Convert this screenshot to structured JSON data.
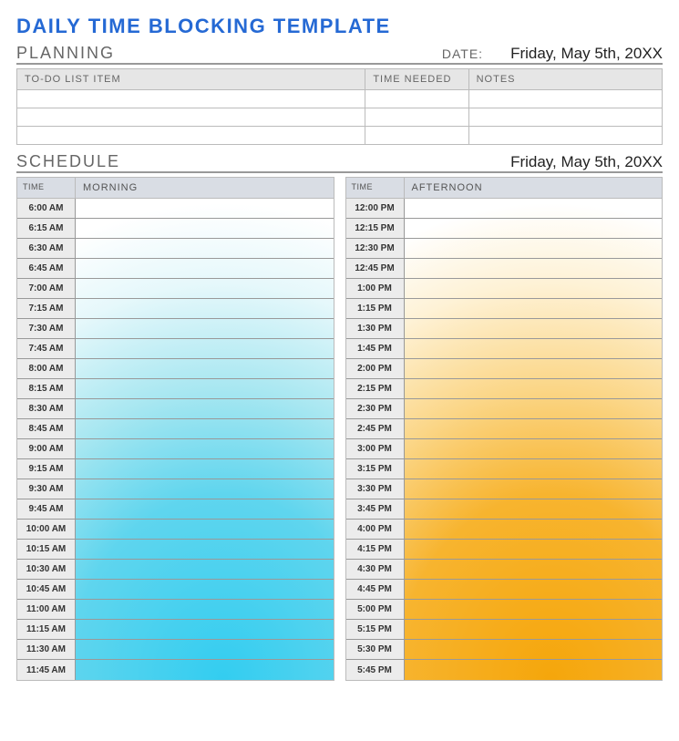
{
  "title": "DAILY TIME BLOCKING TEMPLATE",
  "planning": {
    "label": "PLANNING",
    "date_label": "DATE:",
    "date_value": "Friday, May 5th, 20XX",
    "columns": {
      "item": "TO-DO LIST ITEM",
      "time": "TIME NEEDED",
      "notes": "NOTES"
    },
    "rows": [
      {
        "item": "",
        "time": "",
        "notes": ""
      },
      {
        "item": "",
        "time": "",
        "notes": ""
      },
      {
        "item": "",
        "time": "",
        "notes": ""
      }
    ]
  },
  "schedule": {
    "label": "SCHEDULE",
    "date_value": "Friday, May 5th, 20XX",
    "time_header": "TIME",
    "morning": {
      "label": "MORNING",
      "slots": [
        {
          "time": "6:00 AM",
          "entry": ""
        },
        {
          "time": "6:15 AM",
          "entry": ""
        },
        {
          "time": "6:30 AM",
          "entry": ""
        },
        {
          "time": "6:45 AM",
          "entry": ""
        },
        {
          "time": "7:00 AM",
          "entry": ""
        },
        {
          "time": "7:15 AM",
          "entry": ""
        },
        {
          "time": "7:30 AM",
          "entry": ""
        },
        {
          "time": "7:45 AM",
          "entry": ""
        },
        {
          "time": "8:00 AM",
          "entry": ""
        },
        {
          "time": "8:15 AM",
          "entry": ""
        },
        {
          "time": "8:30 AM",
          "entry": ""
        },
        {
          "time": "8:45 AM",
          "entry": ""
        },
        {
          "time": "9:00 AM",
          "entry": ""
        },
        {
          "time": "9:15 AM",
          "entry": ""
        },
        {
          "time": "9:30 AM",
          "entry": ""
        },
        {
          "time": "9:45 AM",
          "entry": ""
        },
        {
          "time": "10:00 AM",
          "entry": ""
        },
        {
          "time": "10:15 AM",
          "entry": ""
        },
        {
          "time": "10:30 AM",
          "entry": ""
        },
        {
          "time": "10:45 AM",
          "entry": ""
        },
        {
          "time": "11:00 AM",
          "entry": ""
        },
        {
          "time": "11:15 AM",
          "entry": ""
        },
        {
          "time": "11:30 AM",
          "entry": ""
        },
        {
          "time": "11:45 AM",
          "entry": ""
        }
      ]
    },
    "afternoon": {
      "label": "AFTERNOON",
      "slots": [
        {
          "time": "12:00 PM",
          "entry": ""
        },
        {
          "time": "12:15 PM",
          "entry": ""
        },
        {
          "time": "12:30 PM",
          "entry": ""
        },
        {
          "time": "12:45 PM",
          "entry": ""
        },
        {
          "time": "1:00 PM",
          "entry": ""
        },
        {
          "time": "1:15 PM",
          "entry": ""
        },
        {
          "time": "1:30 PM",
          "entry": ""
        },
        {
          "time": "1:45 PM",
          "entry": ""
        },
        {
          "time": "2:00 PM",
          "entry": ""
        },
        {
          "time": "2:15 PM",
          "entry": ""
        },
        {
          "time": "2:30 PM",
          "entry": ""
        },
        {
          "time": "2:45 PM",
          "entry": ""
        },
        {
          "time": "3:00 PM",
          "entry": ""
        },
        {
          "time": "3:15 PM",
          "entry": ""
        },
        {
          "time": "3:30 PM",
          "entry": ""
        },
        {
          "time": "3:45 PM",
          "entry": ""
        },
        {
          "time": "4:00 PM",
          "entry": ""
        },
        {
          "time": "4:15 PM",
          "entry": ""
        },
        {
          "time": "4:30 PM",
          "entry": ""
        },
        {
          "time": "4:45 PM",
          "entry": ""
        },
        {
          "time": "5:00 PM",
          "entry": ""
        },
        {
          "time": "5:15 PM",
          "entry": ""
        },
        {
          "time": "5:30 PM",
          "entry": ""
        },
        {
          "time": "5:45 PM",
          "entry": ""
        }
      ]
    }
  }
}
